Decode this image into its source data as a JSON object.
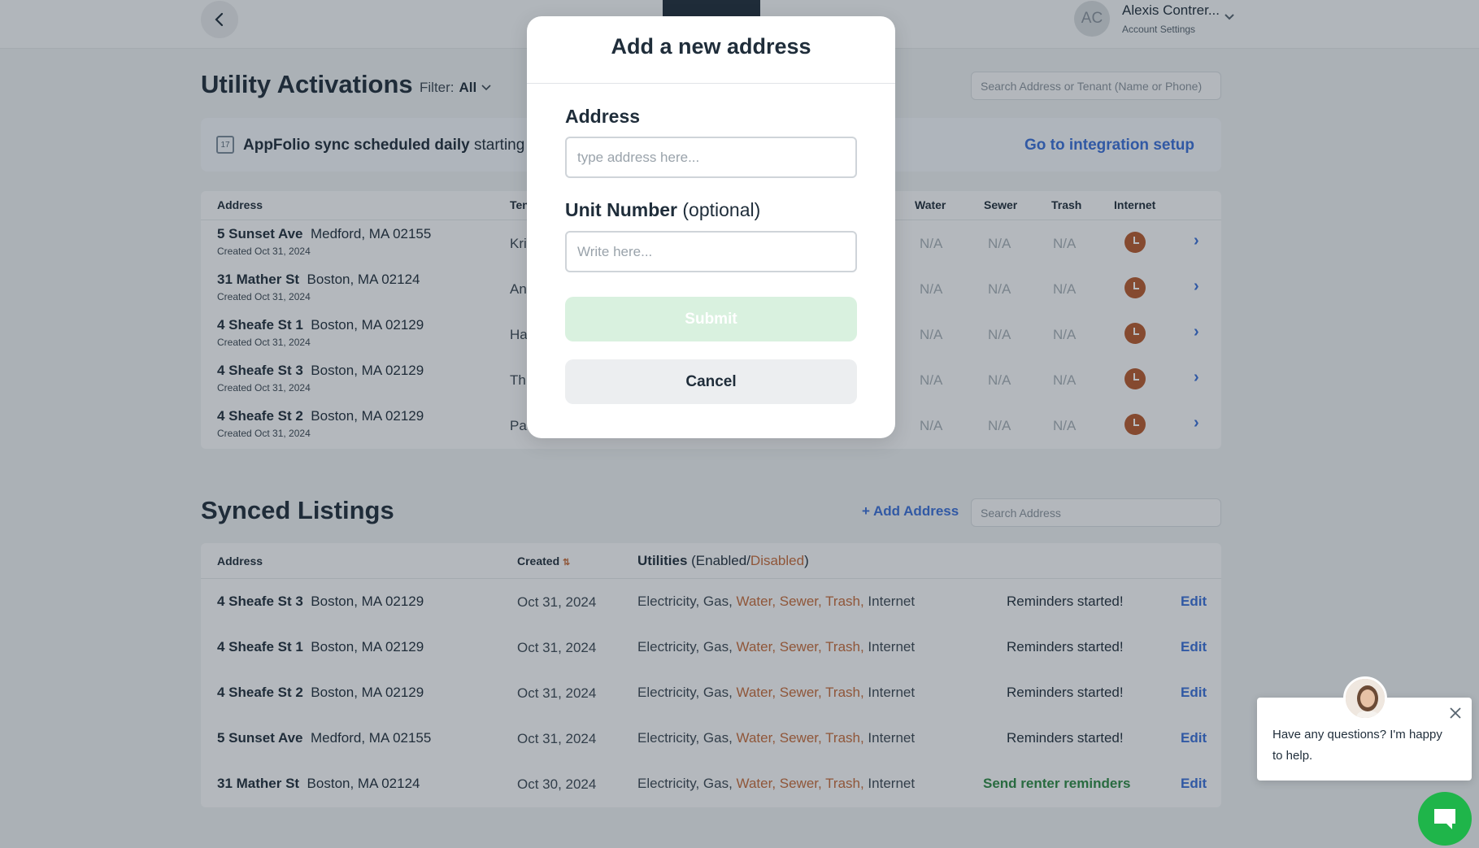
{
  "header": {
    "avatar_initials": "AC",
    "user_name": "Alexis Contrer...",
    "user_subtitle": "Account Settings"
  },
  "activations": {
    "title": "Utility Activations",
    "filter_label": "Filter:",
    "filter_value": "All",
    "search_placeholder": "Search Address or Tenant (Name or Phone)",
    "banner": {
      "bold": "AppFolio sync scheduled daily",
      "rest": " starting t",
      "link": "Go to integration setup"
    },
    "columns": {
      "address": "Address",
      "tenant": "Ten",
      "water": "Water",
      "sewer": "Sewer",
      "trash": "Trash",
      "internet": "Internet"
    },
    "rows": [
      {
        "street": "5 Sunset Ave",
        "city": "Medford, MA 02155",
        "created": "Created Oct 31, 2024",
        "tenant": "Kris",
        "water": "N/A",
        "sewer": "N/A",
        "trash": "N/A"
      },
      {
        "street": "31 Mather St",
        "city": "Boston, MA 02124",
        "created": "Created Oct 31, 2024",
        "tenant": "An",
        "water": "N/A",
        "sewer": "N/A",
        "trash": "N/A"
      },
      {
        "street": "4 Sheafe St 1",
        "city": "Boston, MA 02129",
        "created": "Created Oct 31, 2024",
        "tenant": "Ha",
        "water": "N/A",
        "sewer": "N/A",
        "trash": "N/A"
      },
      {
        "street": "4 Sheafe St 3",
        "city": "Boston, MA 02129",
        "created": "Created Oct 31, 2024",
        "tenant": "Th",
        "water": "N/A",
        "sewer": "N/A",
        "trash": "N/A"
      },
      {
        "street": "4 Sheafe St 2",
        "city": "Boston, MA 02129",
        "created": "Created Oct 31, 2024",
        "tenant": "Pa",
        "water": "N/A",
        "sewer": "N/A",
        "trash": "N/A"
      }
    ]
  },
  "synced": {
    "title": "Synced Listings",
    "add_address": "+ Add Address",
    "search_placeholder": "Search Address",
    "columns": {
      "address": "Address",
      "created": "Created",
      "utilities": "Utilities",
      "utilities_open": "(Enabled/",
      "utilities_disabled": "Disabled",
      "utilities_close": ")"
    },
    "util_enabled_1": "Electricity, Gas, ",
    "util_disabled": "Water, Sewer, Trash, ",
    "util_enabled_2": "Internet",
    "edit_label": "Edit",
    "rows": [
      {
        "street": "4 Sheafe St 3",
        "city": "Boston, MA 02129",
        "created": "Oct 31, 2024",
        "status": "Reminders started!"
      },
      {
        "street": "4 Sheafe St 1",
        "city": "Boston, MA 02129",
        "created": "Oct 31, 2024",
        "status": "Reminders started!"
      },
      {
        "street": "4 Sheafe St 2",
        "city": "Boston, MA 02129",
        "created": "Oct 31, 2024",
        "status": "Reminders started!"
      },
      {
        "street": "5 Sunset Ave",
        "city": "Medford, MA 02155",
        "created": "Oct 31, 2024",
        "status": "Reminders started!"
      },
      {
        "street": "31 Mather St",
        "city": "Boston, MA 02124",
        "created": "Oct 30, 2024",
        "status": "Send renter reminders"
      }
    ]
  },
  "modal": {
    "title": "Add a new address",
    "address_label": "Address",
    "address_placeholder": "type address here...",
    "address_value": "",
    "unit_label": "Unit Number",
    "unit_optional": "(optional)",
    "unit_placeholder": "Write here...",
    "unit_value": "",
    "submit_label": "Submit",
    "submit_enabled": false,
    "cancel_label": "Cancel"
  },
  "chat": {
    "message": "Have any questions? I'm happy to help."
  },
  "icons": {
    "back": "chevron-left-icon",
    "user_menu": "chevron-down-icon",
    "filter": "chevron-down-icon",
    "banner": "calendar-icon",
    "status": "clock-icon",
    "row": "chevron-right-icon",
    "chat_close": "close-icon",
    "chat_launcher": "chat-icon"
  },
  "colors": {
    "primary_link": "#3a6fd8",
    "disabled_utility": "#c56a3a",
    "pending_status": "#b5592d",
    "success": "#2f8a45",
    "submit_disabled_bg": "#d9f1df",
    "chat_launcher": "#1fb54a"
  }
}
